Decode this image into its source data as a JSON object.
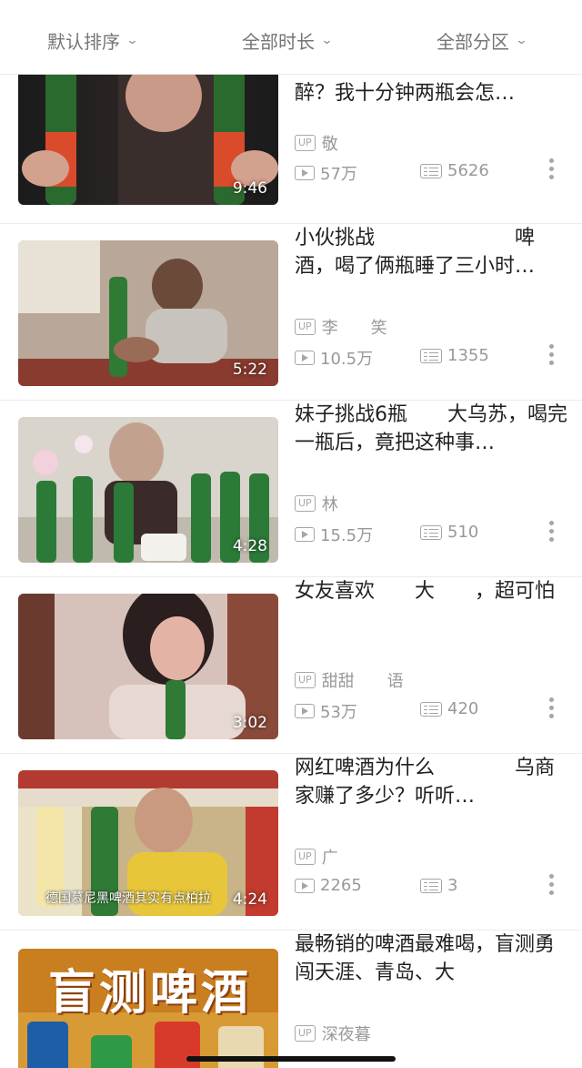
{
  "filters": [
    {
      "label": "默认排序"
    },
    {
      "label": "全部时长"
    },
    {
      "label": "全部分区"
    }
  ],
  "videos": [
    {
      "title": "听说乌苏啤酒一瓶就可以让你醉？我十分钟两瓶会怎…",
      "up": "敬",
      "views": "57万",
      "danmaku": "5626",
      "duration": "9:46"
    },
    {
      "title": "小伙挑战　　　　　　　啤酒，喝了俩瓶睡了三小时…",
      "up": "李　　笑",
      "views": "10.5万",
      "danmaku": "1355",
      "duration": "5:22"
    },
    {
      "title": "妹子挑战6瓶　　大乌苏，喝完一瓶后，竟把这种事…",
      "up": "林",
      "views": "15.5万",
      "danmaku": "510",
      "duration": "4:28"
    },
    {
      "title": "女友喜欢　　大　　，超可怕",
      "up": "甜甜　　语",
      "views": "53万",
      "danmaku": "420",
      "duration": "3:02"
    },
    {
      "title": "网红啤酒为什么　　　　乌商家赚了多少？听听…",
      "up": "广",
      "views": "2265",
      "danmaku": "3",
      "duration": "4:24",
      "caption": "德国慕尼黑啤酒其实有点柏拉"
    },
    {
      "title": "最畅销的啤酒最难喝，盲测勇闯天涯、青岛、大",
      "up": "深夜暮",
      "views": "",
      "danmaku": "",
      "duration": "",
      "banner": "盲测啤酒"
    }
  ],
  "colors": {
    "accent": "#f6a5be",
    "muted": "#999999"
  }
}
